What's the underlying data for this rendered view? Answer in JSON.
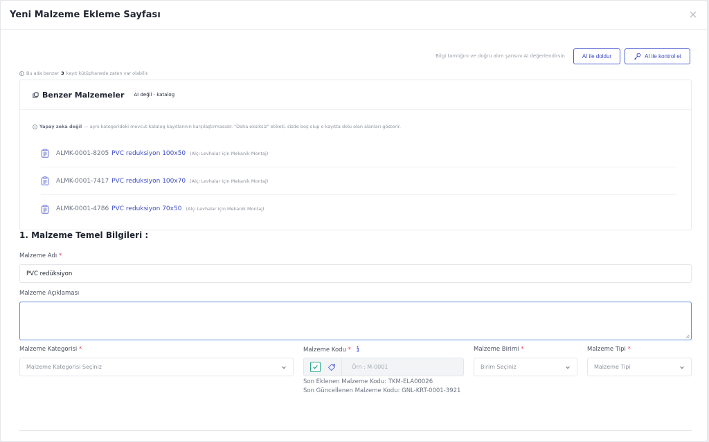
{
  "modal": {
    "title": "Yeni Malzeme Ekleme Sayfası"
  },
  "ai": {
    "hint": "Bilgi tamlığını ve doğru alım şansını AI değerlendirsin",
    "fill_label": "AI ile doldur",
    "check_label": "AI ile kontrol et"
  },
  "duplicate_note": {
    "prefix": "Bu ada benzer",
    "count": "3",
    "suffix": "kayıt kütüphanede zaten var olabilir."
  },
  "similar": {
    "title": "Benzer Malzemeler",
    "badge": "AI değil · katalog",
    "note_bold": "Yapay zeka değil",
    "note_text": "— aynı kategorideki mevcut katalog kayıtlarının karşılaştırmasıdır. \"Daha eksiksiz\" etiketi, sizde boş olup o kayıtta dolu olan alanları gösterir.",
    "items": [
      {
        "code": "ALMK-0001-8205",
        "name": "PVC reduksiyon 100x50",
        "meta": "(Alçı Levhalar için Mekanik Montaj)"
      },
      {
        "code": "ALMK-0001-7417",
        "name": "PVC reduksiyon 100x70",
        "meta": "(Alçı Levhalar için Mekanik Montaj)"
      },
      {
        "code": "ALMK-0001-4786",
        "name": "PVC reduksiyon 70x50",
        "meta": "(Alçı Levhalar için Mekanik Montaj)"
      }
    ]
  },
  "section": {
    "title": "1. Malzeme Temel Bilgileri :"
  },
  "form": {
    "name_label": "Malzeme Adı",
    "name_value": "PVC redüksiyon",
    "desc_label": "Malzeme Açıklaması",
    "category_label": "Malzeme Kategorisi",
    "category_placeholder": "Malzeme Kategorisi Seçiniz",
    "code_label": "Malzeme Kodu",
    "code_placeholder": "Örn : M-0001",
    "unit_label": "Malzeme Birimi",
    "unit_placeholder": "Birim Seçiniz",
    "type_label": "Malzeme Tipi",
    "type_placeholder": "Malzeme Tipi",
    "required_mark": "*",
    "last_added": "Son Eklenen Malzeme Kodu: TKM-ELA00026",
    "last_updated": "Son Güncellenen Malzeme Kodu: GNL-KRT-0001-3921"
  },
  "colors": {
    "accent": "#4b5bd1",
    "required": "#e0475a",
    "check": "#2aa889"
  }
}
